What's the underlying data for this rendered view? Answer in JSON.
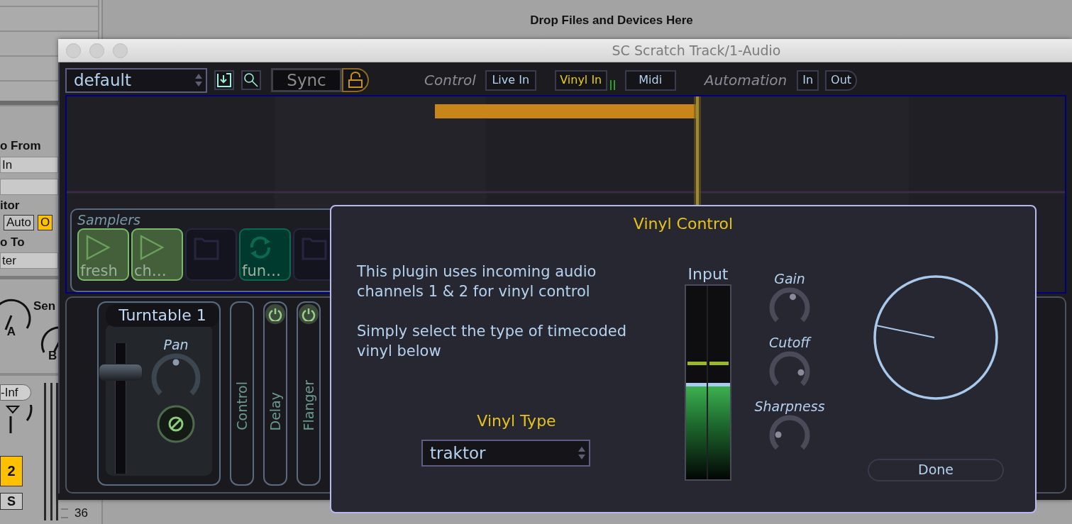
{
  "host": {
    "drop_hint": "Drop Files and Devices Here",
    "mixer": {
      "input_heading": "o From",
      "input_value": "In",
      "monitor_heading": "itor",
      "monitor_options": [
        {
          "label": "Auto",
          "selected": false
        },
        {
          "label": "O",
          "selected": true
        }
      ],
      "output_heading": "o To",
      "output_value": "ter",
      "sends_label": "Sen",
      "send_knobs": [
        "A",
        "B"
      ],
      "volume": "-Inf",
      "track_number": "2",
      "solo": "S",
      "scale_mark": "36"
    }
  },
  "window": {
    "title": "SC Scratch Track/1-Audio"
  },
  "toolbar": {
    "preset": "default",
    "sync": "Sync",
    "control_label": "Control",
    "control_sources": [
      {
        "label": "Live In",
        "selected": false
      },
      {
        "label": "Vinyl In",
        "selected": true
      },
      {
        "label": "Midi",
        "selected": false
      }
    ],
    "automation_label": "Automation",
    "automation": [
      {
        "label": "In"
      },
      {
        "label": "Out"
      }
    ]
  },
  "samplers": {
    "title": "Samplers",
    "slots": [
      {
        "kind": "play",
        "label": "fresh"
      },
      {
        "kind": "play",
        "label": "ch…"
      },
      {
        "kind": "empty"
      },
      {
        "kind": "loop",
        "label": "fun…"
      },
      {
        "kind": "empty"
      }
    ]
  },
  "deck": {
    "title": "Turntable 1",
    "fader": {
      "level": 0.82
    },
    "pan": {
      "label": "Pan",
      "level": 0.5
    },
    "effects": [
      {
        "label": "Control",
        "kind": "plain"
      },
      {
        "label": "Delay",
        "kind": "toggle"
      },
      {
        "label": "Flanger",
        "kind": "toggle"
      }
    ]
  },
  "dialog": {
    "title": "Vinyl Control",
    "paragraphs": [
      "This plugin uses incoming audio channels 1 & 2 for vinyl control",
      "Simply select the type of timecoded vinyl below"
    ],
    "vinyl_type_label": "Vinyl Type",
    "vinyl_type": "traktor",
    "input": {
      "label": "Input",
      "level": 0.5
    },
    "knobs": [
      {
        "label": "Gain",
        "level": 0.56
      },
      {
        "label": "Cutoff",
        "level": 0.85
      },
      {
        "label": "Sharpness",
        "level": 0.18
      }
    ],
    "done": "Done"
  }
}
